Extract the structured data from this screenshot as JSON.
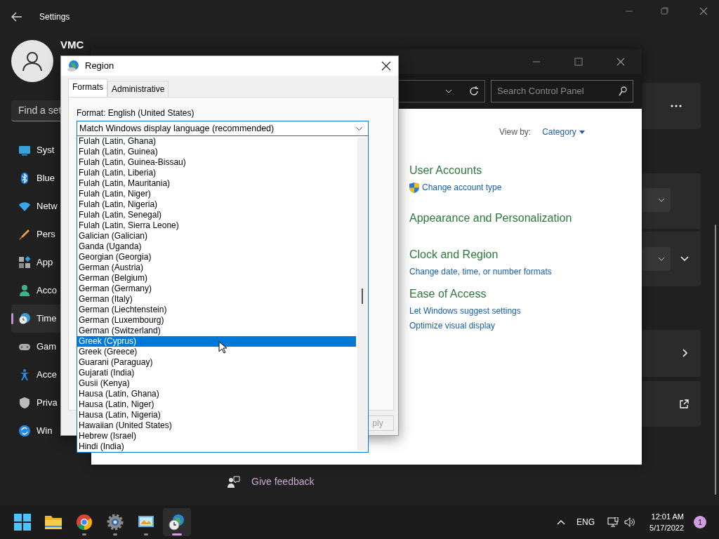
{
  "settings": {
    "title": "Settings",
    "user_name": "VMC",
    "search_placeholder": "Find a set",
    "feedback": "Give feedback",
    "nav_items": [
      {
        "label": "Syst",
        "selected": false
      },
      {
        "label": "Blue",
        "selected": false
      },
      {
        "label": "Netw",
        "selected": false
      },
      {
        "label": "Pers",
        "selected": false
      },
      {
        "label": "App",
        "selected": false
      },
      {
        "label": "Acco",
        "selected": false
      },
      {
        "label": "Time",
        "selected": true
      },
      {
        "label": "Gam",
        "selected": false
      },
      {
        "label": "Acce",
        "selected": false
      },
      {
        "label": "Priva",
        "selected": false
      },
      {
        "label": "Win",
        "selected": false
      }
    ]
  },
  "control_panel": {
    "search_placeholder": "Search Control Panel",
    "view_by_label": "View by:",
    "view_by_value": "Category",
    "categories": [
      {
        "title": "User Accounts",
        "links": [
          {
            "text": "Change account type",
            "kind": "admin"
          }
        ]
      },
      {
        "title": "Appearance and Personalization"
      },
      {
        "title": "Clock and Region",
        "links": [
          {
            "text": "Change date, time, or number formats",
            "kind": "plain"
          }
        ]
      },
      {
        "title": "Ease of Access",
        "links": [
          {
            "text": "Let Windows suggest settings",
            "kind": "plain"
          },
          {
            "text": "Optimize visual display",
            "kind": "plain"
          }
        ]
      }
    ]
  },
  "region_dialog": {
    "title": "Region",
    "tabs": [
      {
        "label": "Formats",
        "selected": true
      },
      {
        "label": "Administrative",
        "selected": false
      }
    ],
    "format_label": "Format: English (United States)",
    "format_value": "Match Windows display language (recommended)",
    "options": [
      {
        "label": "Fulah (Latin, Ghana)",
        "selected": false
      },
      {
        "label": "Fulah (Latin, Guinea)",
        "selected": false
      },
      {
        "label": "Fulah (Latin, Guinea-Bissau)",
        "selected": false
      },
      {
        "label": "Fulah (Latin, Liberia)",
        "selected": false
      },
      {
        "label": "Fulah (Latin, Mauritania)",
        "selected": false
      },
      {
        "label": "Fulah (Latin, Niger)",
        "selected": false
      },
      {
        "label": "Fulah (Latin, Nigeria)",
        "selected": false
      },
      {
        "label": "Fulah (Latin, Senegal)",
        "selected": false
      },
      {
        "label": "Fulah (Latin, Sierra Leone)",
        "selected": false
      },
      {
        "label": "Galician (Galician)",
        "selected": false
      },
      {
        "label": "Ganda (Uganda)",
        "selected": false
      },
      {
        "label": "Georgian (Georgia)",
        "selected": false
      },
      {
        "label": "German (Austria)",
        "selected": false
      },
      {
        "label": "German (Belgium)",
        "selected": false
      },
      {
        "label": "German (Germany)",
        "selected": false
      },
      {
        "label": "German (Italy)",
        "selected": false
      },
      {
        "label": "German (Liechtenstein)",
        "selected": false
      },
      {
        "label": "German (Luxembourg)",
        "selected": false
      },
      {
        "label": "German (Switzerland)",
        "selected": false
      },
      {
        "label": "Greek (Cyprus)",
        "selected": true
      },
      {
        "label": "Greek (Greece)",
        "selected": false
      },
      {
        "label": "Guarani (Paraguay)",
        "selected": false
      },
      {
        "label": "Gujarati (India)",
        "selected": false
      },
      {
        "label": "Gusii (Kenya)",
        "selected": false
      },
      {
        "label": "Hausa (Latin, Ghana)",
        "selected": false
      },
      {
        "label": "Hausa (Latin, Niger)",
        "selected": false
      },
      {
        "label": "Hausa (Latin, Nigeria)",
        "selected": false
      },
      {
        "label": "Hawaiian (United States)",
        "selected": false
      },
      {
        "label": "Hebrew (Israel)",
        "selected": false
      },
      {
        "label": "Hindi (India)",
        "selected": false
      }
    ],
    "apply_button": "ply"
  },
  "taskbar": {
    "apps": [
      {
        "kind": "start",
        "running": false,
        "selected": false
      },
      {
        "kind": "folder",
        "running": false,
        "selected": false
      },
      {
        "kind": "browser",
        "running": true,
        "selected": false
      },
      {
        "kind": "settings",
        "running": true,
        "selected": false
      },
      {
        "kind": "control",
        "running": true,
        "selected": false
      },
      {
        "kind": "region",
        "running": true,
        "selected": true
      }
    ],
    "language": "ENG",
    "time": "12:01 AM",
    "date": "5/17/2022",
    "notification_count": "1"
  }
}
